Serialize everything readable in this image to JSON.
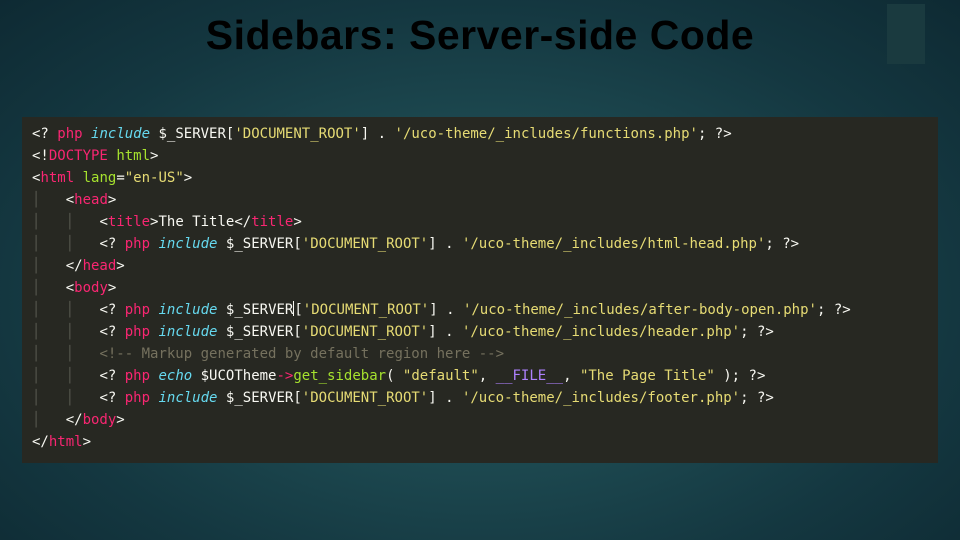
{
  "title": "Sidebars: Server-side Code",
  "indent_unit": "│   ",
  "code": [
    {
      "indent": 0,
      "tokens": [
        {
          "t": "c-del",
          "v": "<? "
        },
        {
          "t": "c-tag",
          "v": "php"
        },
        {
          "t": "c-del",
          "v": " "
        },
        {
          "t": "c-kw",
          "v": "include"
        },
        {
          "t": "c-del",
          "v": " "
        },
        {
          "t": "c-var",
          "v": "$_SERVER"
        },
        {
          "t": "c-del",
          "v": "["
        },
        {
          "t": "c-str",
          "v": "'DOCUMENT_ROOT'"
        },
        {
          "t": "c-del",
          "v": "] . "
        },
        {
          "t": "c-str",
          "v": "'/uco-theme/_includes/functions.php'"
        },
        {
          "t": "c-del",
          "v": "; ?>"
        }
      ]
    },
    {
      "indent": 0,
      "tokens": [
        {
          "t": "c-del",
          "v": "<!"
        },
        {
          "t": "c-tag",
          "v": "DOCTYPE"
        },
        {
          "t": "c-del",
          "v": " "
        },
        {
          "t": "c-attr",
          "v": "html"
        },
        {
          "t": "c-del",
          "v": ">"
        }
      ]
    },
    {
      "indent": 0,
      "tokens": [
        {
          "t": "c-del",
          "v": "<"
        },
        {
          "t": "c-tag",
          "v": "html"
        },
        {
          "t": "c-del",
          "v": " "
        },
        {
          "t": "c-attr",
          "v": "lang"
        },
        {
          "t": "c-del",
          "v": "="
        },
        {
          "t": "c-str",
          "v": "\"en-US\""
        },
        {
          "t": "c-del",
          "v": ">"
        }
      ]
    },
    {
      "indent": 1,
      "tokens": [
        {
          "t": "c-del",
          "v": "<"
        },
        {
          "t": "c-tag",
          "v": "head"
        },
        {
          "t": "c-del",
          "v": ">"
        }
      ]
    },
    {
      "indent": 2,
      "tokens": [
        {
          "t": "c-del",
          "v": "<"
        },
        {
          "t": "c-tag",
          "v": "title"
        },
        {
          "t": "c-del",
          "v": ">"
        },
        {
          "t": "c-del",
          "v": "The Title"
        },
        {
          "t": "c-del",
          "v": "</"
        },
        {
          "t": "c-tag",
          "v": "title"
        },
        {
          "t": "c-del",
          "v": ">"
        }
      ]
    },
    {
      "indent": 2,
      "tokens": [
        {
          "t": "c-del",
          "v": "<? "
        },
        {
          "t": "c-tag",
          "v": "php"
        },
        {
          "t": "c-del",
          "v": " "
        },
        {
          "t": "c-kw",
          "v": "include"
        },
        {
          "t": "c-del",
          "v": " "
        },
        {
          "t": "c-var",
          "v": "$_SERVER"
        },
        {
          "t": "c-del",
          "v": "["
        },
        {
          "t": "c-str",
          "v": "'DOCUMENT_ROOT'"
        },
        {
          "t": "c-del",
          "v": "] . "
        },
        {
          "t": "c-str",
          "v": "'/uco-theme/_includes/html-head.php'"
        },
        {
          "t": "c-del",
          "v": "; ?>"
        }
      ]
    },
    {
      "indent": 1,
      "tokens": [
        {
          "t": "c-del",
          "v": "</"
        },
        {
          "t": "c-tag",
          "v": "head"
        },
        {
          "t": "c-del",
          "v": ">"
        }
      ]
    },
    {
      "indent": 1,
      "tokens": [
        {
          "t": "c-del",
          "v": "<"
        },
        {
          "t": "c-tag",
          "v": "body"
        },
        {
          "t": "c-del",
          "v": ">"
        }
      ]
    },
    {
      "indent": 2,
      "cursor_after_token": 6,
      "tokens": [
        {
          "t": "c-del",
          "v": "<? "
        },
        {
          "t": "c-tag",
          "v": "php"
        },
        {
          "t": "c-del",
          "v": " "
        },
        {
          "t": "c-kw",
          "v": "include"
        },
        {
          "t": "c-del",
          "v": " "
        },
        {
          "t": "c-var",
          "v": "$_SERV"
        },
        {
          "t": "c-var",
          "v": "ER"
        },
        {
          "t": "c-del",
          "v": "["
        },
        {
          "t": "c-str",
          "v": "'DOCUMENT_ROOT'"
        },
        {
          "t": "c-del",
          "v": "] . "
        },
        {
          "t": "c-str",
          "v": "'/uco-theme/_includes/after-body-open.php'"
        },
        {
          "t": "c-del",
          "v": "; ?>"
        }
      ]
    },
    {
      "indent": 2,
      "tokens": [
        {
          "t": "c-del",
          "v": "<? "
        },
        {
          "t": "c-tag",
          "v": "php"
        },
        {
          "t": "c-del",
          "v": " "
        },
        {
          "t": "c-kw",
          "v": "include"
        },
        {
          "t": "c-del",
          "v": " "
        },
        {
          "t": "c-var",
          "v": "$_SERVER"
        },
        {
          "t": "c-del",
          "v": "["
        },
        {
          "t": "c-str",
          "v": "'DOCUMENT_ROOT'"
        },
        {
          "t": "c-del",
          "v": "] . "
        },
        {
          "t": "c-str",
          "v": "'/uco-theme/_includes/header.php'"
        },
        {
          "t": "c-del",
          "v": "; ?>"
        }
      ]
    },
    {
      "indent": 2,
      "tokens": [
        {
          "t": "c-cmt",
          "v": "<!-- Markup generated by default region here -->"
        }
      ]
    },
    {
      "indent": 2,
      "tokens": [
        {
          "t": "c-del",
          "v": "<? "
        },
        {
          "t": "c-tag",
          "v": "php"
        },
        {
          "t": "c-del",
          "v": " "
        },
        {
          "t": "c-kw",
          "v": "echo"
        },
        {
          "t": "c-del",
          "v": " "
        },
        {
          "t": "c-var",
          "v": "$UCOTheme"
        },
        {
          "t": "c-tag",
          "v": "->"
        },
        {
          "t": "c-func",
          "v": "get_sidebar"
        },
        {
          "t": "c-del",
          "v": "( "
        },
        {
          "t": "c-str",
          "v": "\"default\""
        },
        {
          "t": "c-del",
          "v": ", "
        },
        {
          "t": "c-purple",
          "v": "__FILE__"
        },
        {
          "t": "c-del",
          "v": ", "
        },
        {
          "t": "c-str",
          "v": "\"The Page Title\""
        },
        {
          "t": "c-del",
          "v": " ); ?>"
        }
      ]
    },
    {
      "indent": 2,
      "tokens": [
        {
          "t": "c-del",
          "v": "<? "
        },
        {
          "t": "c-tag",
          "v": "php"
        },
        {
          "t": "c-del",
          "v": " "
        },
        {
          "t": "c-kw",
          "v": "include"
        },
        {
          "t": "c-del",
          "v": " "
        },
        {
          "t": "c-var",
          "v": "$_SERVER"
        },
        {
          "t": "c-del",
          "v": "["
        },
        {
          "t": "c-str",
          "v": "'DOCUMENT_ROOT'"
        },
        {
          "t": "c-del",
          "v": "] . "
        },
        {
          "t": "c-str",
          "v": "'/uco-theme/_includes/footer.php'"
        },
        {
          "t": "c-del",
          "v": "; ?>"
        }
      ]
    },
    {
      "indent": 1,
      "tokens": [
        {
          "t": "c-del",
          "v": "</"
        },
        {
          "t": "c-tag",
          "v": "body"
        },
        {
          "t": "c-del",
          "v": ">"
        }
      ]
    },
    {
      "indent": 0,
      "tokens": [
        {
          "t": "c-del",
          "v": "</"
        },
        {
          "t": "c-tag",
          "v": "html"
        },
        {
          "t": "c-del",
          "v": ">"
        }
      ]
    }
  ]
}
